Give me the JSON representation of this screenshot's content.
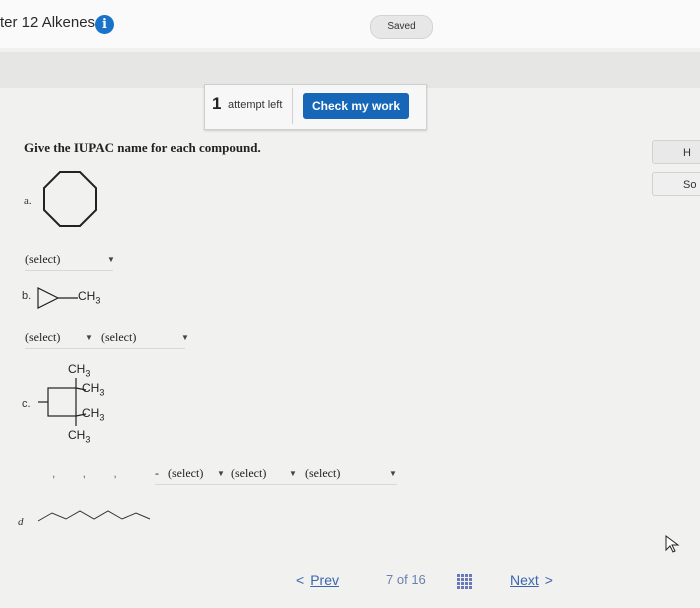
{
  "header": {
    "chapter_title": "ter 12 Alkenes",
    "info_icon_glyph": "i",
    "saved_label": "Saved"
  },
  "attempt": {
    "count": "1",
    "label": "attempt left",
    "check_button": "Check my work"
  },
  "side_tabs": [
    "H",
    "So"
  ],
  "question": "Give the IUPAC name for each compound.",
  "parts": {
    "a": {
      "label": "a.",
      "select": "(select)"
    },
    "b": {
      "label": "b.",
      "substituent": "CH",
      "substituent_sub": "3",
      "select1": "(select)",
      "select2": "(select)"
    },
    "c": {
      "label": "c.",
      "groups": [
        {
          "text": "CH",
          "sub": "3"
        },
        {
          "text": "CH",
          "sub": "3"
        },
        {
          "text": "CH",
          "sub": "3"
        },
        {
          "text": "CH",
          "sub": "3"
        }
      ],
      "dots": ", , ,",
      "dash": "-",
      "select1": "(select)",
      "select2": "(select)",
      "select3": "(select)"
    },
    "d": {
      "label": "d"
    }
  },
  "nav": {
    "prev_chevron": "<",
    "prev_label": "Prev",
    "page_current": "7",
    "page_of": "of",
    "page_total": "16",
    "next_label": "Next",
    "next_chevron": ">"
  },
  "colors": {
    "accent": "#1767b8",
    "info_icon": "#1a73c8",
    "link": "#3a66b0",
    "background": "#f1f1ef"
  },
  "icons": {
    "info": "info-icon",
    "grid": "grid-icon",
    "cursor": "cursor-icon",
    "dropdown": "caret-down-icon"
  }
}
